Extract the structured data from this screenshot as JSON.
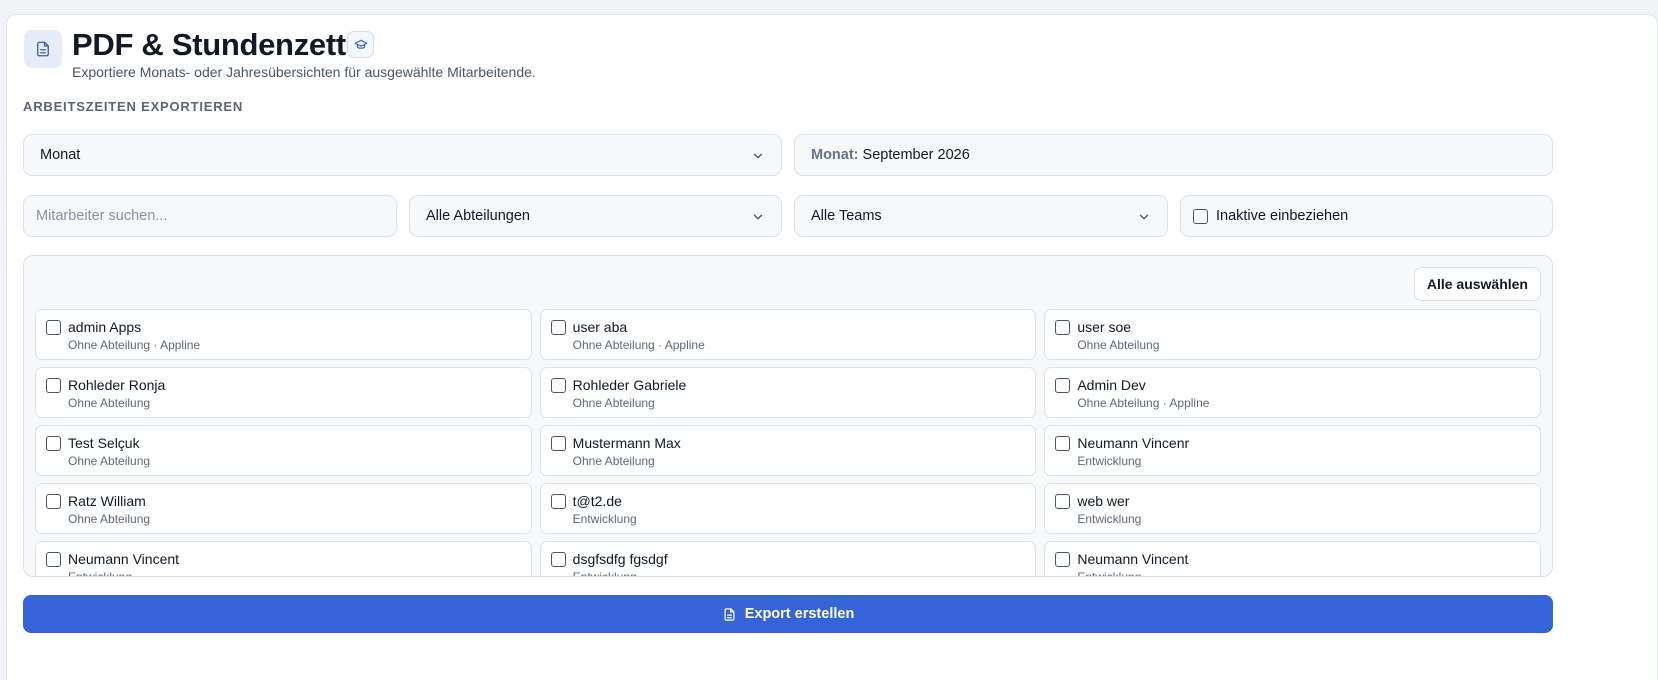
{
  "header": {
    "title": "PDF & Stundenzettel",
    "subtitle": "Exportiere Monats- oder Jahresübersichten für ausgewählte Mitarbeitende.",
    "icon": "document-icon",
    "badge_icon": "graduation-cap-icon"
  },
  "section": {
    "label": "ARBEITSZEITEN EXPORTIEREN"
  },
  "filters": {
    "period_type": "Monat",
    "period_prefix": "Monat:",
    "period_value": "September 2026",
    "search_placeholder": "Mitarbeiter suchen...",
    "department": "Alle Abteilungen",
    "team": "Alle Teams",
    "inactive_label": "Inaktive einbeziehen"
  },
  "list": {
    "select_all_label": "Alle auswählen",
    "employees": [
      {
        "name": "admin Apps",
        "meta": "Ohne Abteilung · Appline"
      },
      {
        "name": "user aba",
        "meta": "Ohne Abteilung · Appline"
      },
      {
        "name": "user soe",
        "meta": "Ohne Abteilung"
      },
      {
        "name": "Rohleder Ronja",
        "meta": "Ohne Abteilung"
      },
      {
        "name": "Rohleder Gabriele",
        "meta": "Ohne Abteilung"
      },
      {
        "name": "Admin Dev",
        "meta": "Ohne Abteilung · Appline"
      },
      {
        "name": "Test Selçuk",
        "meta": "Ohne Abteilung"
      },
      {
        "name": "Mustermann Max",
        "meta": "Ohne Abteilung"
      },
      {
        "name": "Neumann Vincenr",
        "meta": "Entwicklung"
      },
      {
        "name": "Ratz William",
        "meta": "Ohne Abteilung"
      },
      {
        "name": "t@t2.de",
        "meta": "Entwicklung"
      },
      {
        "name": "web wer",
        "meta": "Entwicklung"
      },
      {
        "name": "Neumann Vincent",
        "meta": "Entwicklung"
      },
      {
        "name": "dsgfsdfg fgsdgf",
        "meta": "Entwicklung"
      },
      {
        "name": "Neumann Vincent",
        "meta": "Entwicklung"
      }
    ]
  },
  "actions": {
    "export_label": "Export erstellen",
    "export_icon": "document-icon"
  },
  "colors": {
    "accent": "#3563d8",
    "icon_bg": "#e6ecf8"
  }
}
